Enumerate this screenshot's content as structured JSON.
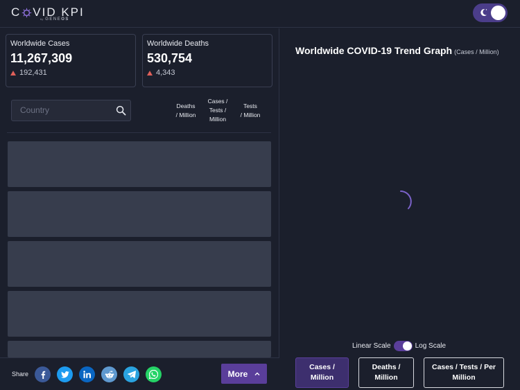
{
  "header": {
    "logo_prefix": "C",
    "logo_suffix": "VID KPI",
    "logo_by": "by",
    "logo_brand_a": "GENE",
    "logo_brand_b": "OS",
    "theme_icon": "moon-icon"
  },
  "stats": [
    {
      "label": "Worldwide Cases",
      "value": "11,267,309",
      "delta": "192,431"
    },
    {
      "label": "Worldwide Deaths",
      "value": "530,754",
      "delta": "4,343"
    }
  ],
  "search": {
    "placeholder": "Country",
    "icon": "search-icon"
  },
  "columns": [
    {
      "label": "Deaths\n/ Million"
    },
    {
      "label": "Cases /\nTests /\nMillion"
    },
    {
      "label": "Tests\n/ Million"
    }
  ],
  "footer": {
    "share_label": "Share",
    "share_icons": [
      "facebook-icon",
      "twitter-icon",
      "linkedin-icon",
      "reddit-icon",
      "telegram-icon",
      "whatsapp-icon"
    ],
    "more_label": "More",
    "more_icon": "chevron-up-icon"
  },
  "graph": {
    "title": "Worldwide COVID-19 Trend Graph",
    "subtitle": "(Cases / Million)",
    "scale_linear": "Linear Scale",
    "scale_log": "Log Scale",
    "log_scale_enabled": true,
    "buttons": [
      {
        "label": "Cases /\nMillion",
        "active": true
      },
      {
        "label": "Deaths /\nMillion",
        "active": false
      },
      {
        "label": "Cases / Tests / Per\nMillion",
        "active": false
      }
    ]
  },
  "colors": {
    "background": "#1b1f2c",
    "accent": "#5a3e9a",
    "delta_up": "#e0605a",
    "placeholder_row": "#373d4d"
  }
}
